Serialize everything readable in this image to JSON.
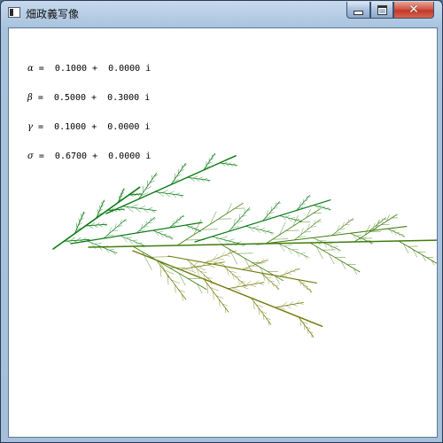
{
  "window": {
    "title": "畑政義写像",
    "close_glyph": "✕"
  },
  "parameters": [
    {
      "symbol": "α",
      "value": "=  0.1000 +  0.0000 i"
    },
    {
      "symbol": "β",
      "value": "=  0.5000 +  0.3000 i"
    },
    {
      "symbol": "γ",
      "value": "=  0.1000 +  0.0000 i"
    },
    {
      "symbol": "σ",
      "value": "=  0.6700 +  0.0000 i"
    }
  ],
  "colors": {
    "upper_branch": "#0a7a12",
    "lower_branch": "#6e7a05",
    "mid_blend": "#3f7d0c"
  }
}
